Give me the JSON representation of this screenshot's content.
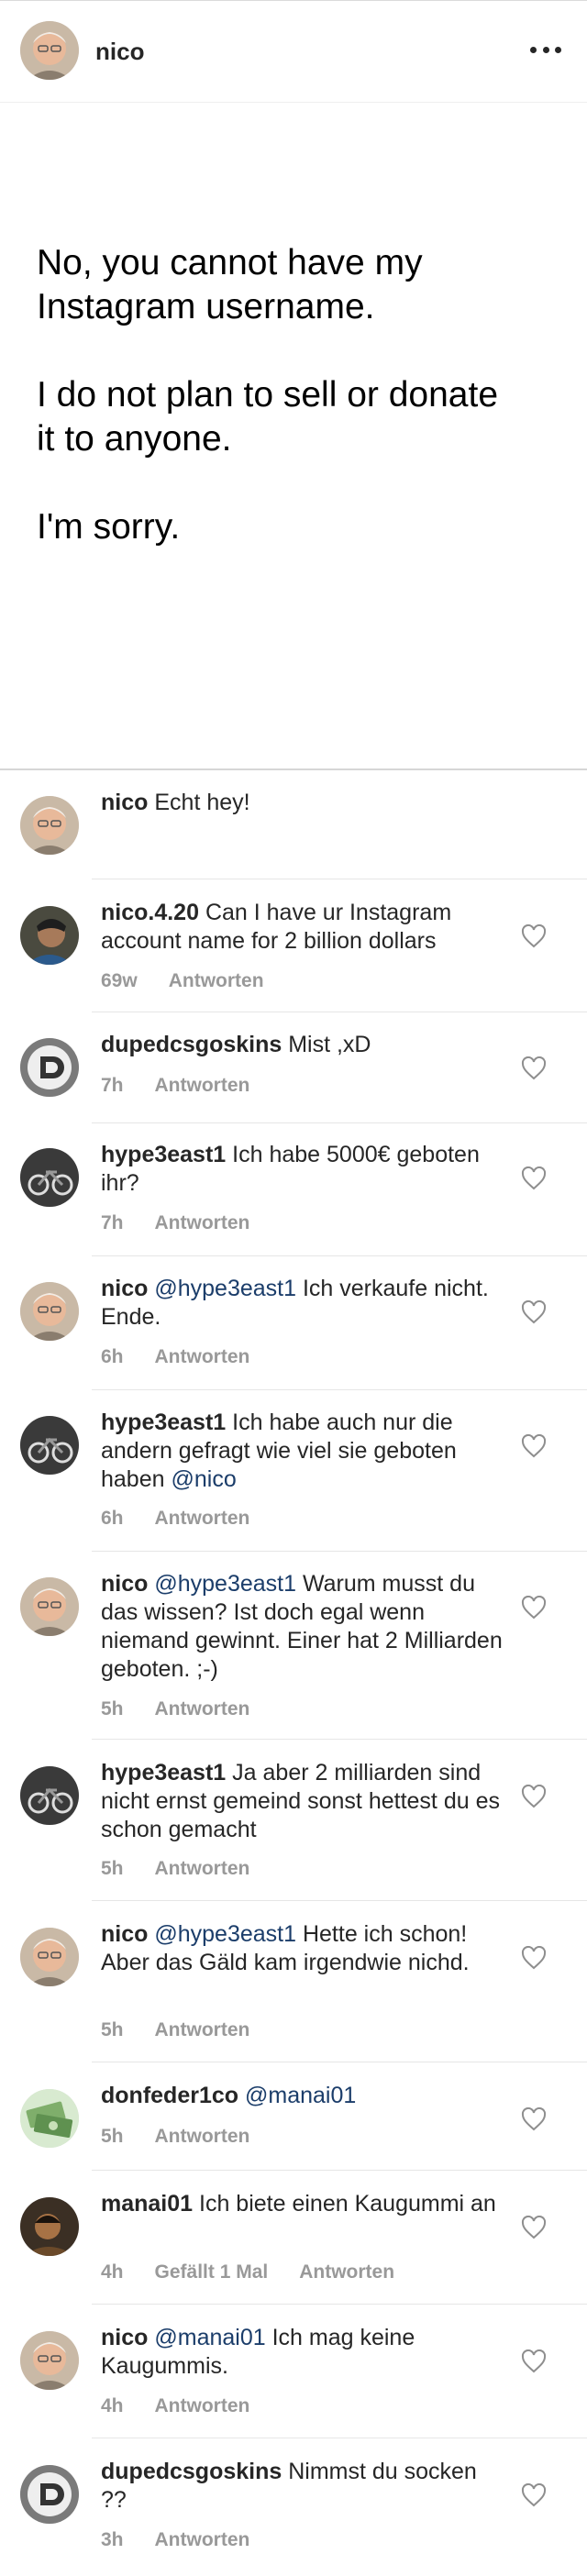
{
  "header": {
    "username": "nico"
  },
  "post": {
    "text": "No, you cannot have my\nInstagram username.\n\nI do not plan to sell or donate\nit to anyone.\n\nI'm sorry."
  },
  "comments": [
    {
      "user": "nico",
      "pre": "",
      "mention": "",
      "text": "Echt hey!",
      "time": "",
      "likes": "",
      "reply": ""
    },
    {
      "user": "nico.4.20",
      "pre": "",
      "mention": "",
      "text": "Can I have ur Instagram account name for 2 billion dollars",
      "time": "69w",
      "likes": "",
      "reply": "Antworten"
    },
    {
      "user": "dupedcsgoskins",
      "pre": "",
      "mention": "",
      "text": "Mist ,xD",
      "time": "7h",
      "likes": "",
      "reply": "Antworten"
    },
    {
      "user": "hype3east1",
      "pre": "",
      "mention": "",
      "text": "Ich habe 5000€ geboten ihr?",
      "time": "7h",
      "likes": "",
      "reply": "Antworten"
    },
    {
      "user": "nico",
      "pre": "",
      "mention": "@hype3east1",
      "text": "Ich verkaufe nicht. Ende.",
      "time": "6h",
      "likes": "",
      "reply": "Antworten"
    },
    {
      "user": "hype3east1",
      "pre": "Ich habe auch nur die andern gefragt wie viel sie geboten haben",
      "mention": "@nico",
      "text": "",
      "time": "6h",
      "likes": "",
      "reply": "Antworten"
    },
    {
      "user": "nico",
      "pre": "",
      "mention": "@hype3east1",
      "text": "Warum musst du das wissen? Ist doch egal wenn niemand gewinnt. Einer hat 2 Milliarden geboten. ;-)",
      "time": "5h",
      "likes": "",
      "reply": "Antworten"
    },
    {
      "user": "hype3east1",
      "pre": "",
      "mention": "",
      "text": "Ja aber 2 milliarden sind nicht ernst gemeind sonst hettest du es schon gemacht",
      "time": "5h",
      "likes": "",
      "reply": "Antworten"
    },
    {
      "user": "nico",
      "pre": "",
      "mention": "@hype3east1",
      "text": "Hette ich schon! Aber das Gäld kam irgendwie nichd.",
      "time": "5h",
      "likes": "",
      "reply": "Antworten"
    },
    {
      "user": "donfeder1co",
      "pre": "",
      "mention": "@manai01",
      "text": "",
      "time": "5h",
      "likes": "",
      "reply": "Antworten"
    },
    {
      "user": "manai01",
      "pre": "",
      "mention": "",
      "text": "Ich biete einen Kaugummi an",
      "time": "4h",
      "likes": "Gefällt 1 Mal",
      "reply": "Antworten"
    },
    {
      "user": "nico",
      "pre": "",
      "mention": "@manai01",
      "text": "Ich mag keine Kaugummis.",
      "time": "4h",
      "likes": "",
      "reply": "Antworten"
    },
    {
      "user": "dupedcsgoskins",
      "pre": "",
      "mention": "",
      "text": "Nimmst du socken ??",
      "time": "3h",
      "likes": "",
      "reply": "Antworten"
    }
  ]
}
